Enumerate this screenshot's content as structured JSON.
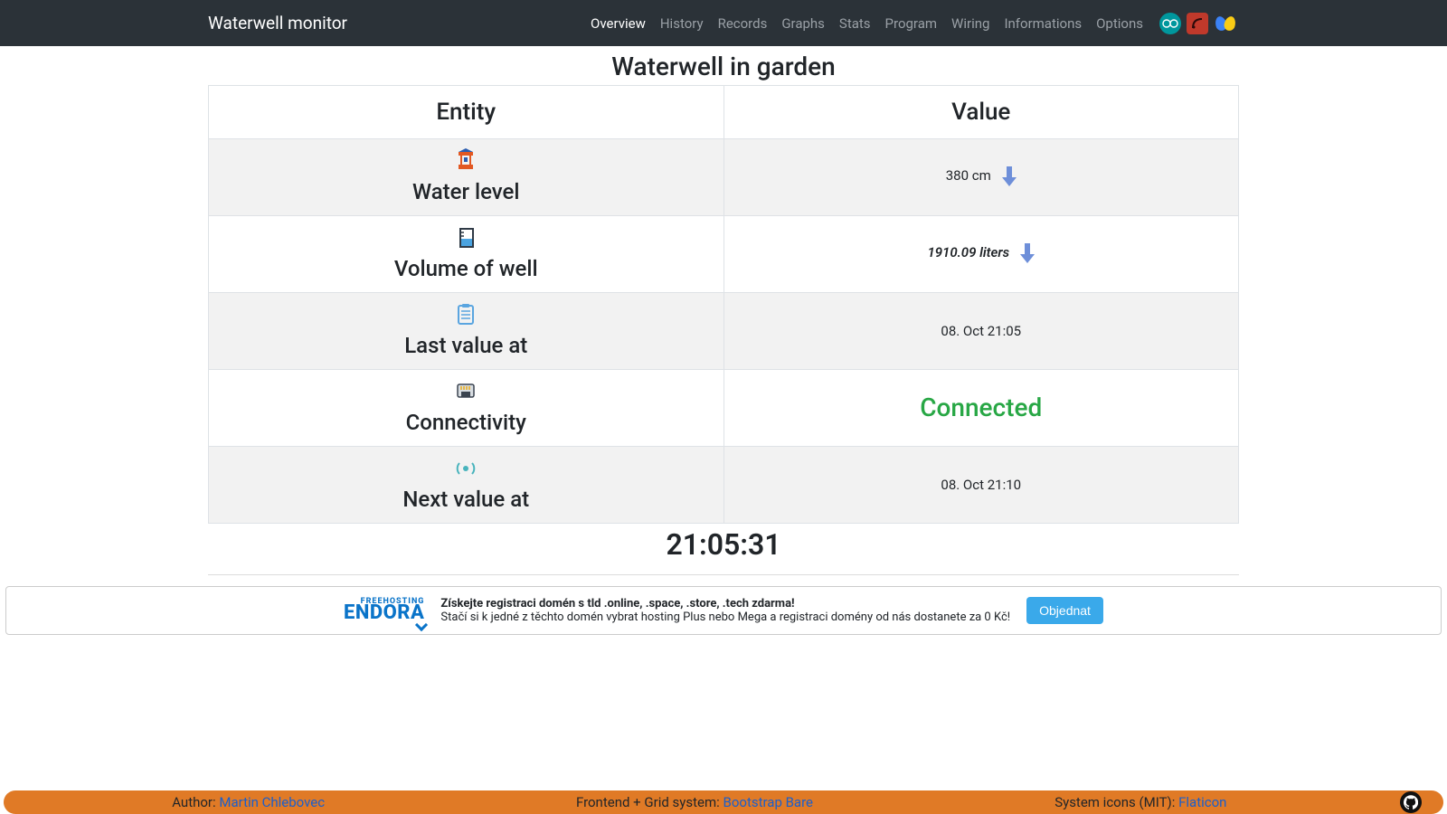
{
  "brand": "Waterwell monitor",
  "nav": [
    {
      "label": "Overview",
      "active": true
    },
    {
      "label": "History",
      "active": false
    },
    {
      "label": "Records",
      "active": false
    },
    {
      "label": "Graphs",
      "active": false
    },
    {
      "label": "Stats",
      "active": false
    },
    {
      "label": "Program",
      "active": false
    },
    {
      "label": "Wiring",
      "active": false
    },
    {
      "label": "Informations",
      "active": false
    },
    {
      "label": "Options",
      "active": false
    }
  ],
  "page_title": "Waterwell in garden",
  "table": {
    "head_entity": "Entity",
    "head_value": "Value"
  },
  "rows": {
    "water_level": {
      "label": "Water level",
      "value": "380 cm"
    },
    "volume": {
      "label": "Volume of well",
      "value": "1910.09 liters"
    },
    "last_at": {
      "label": "Last value at",
      "value": "08. Oct 21:05"
    },
    "connectivity": {
      "label": "Connectivity",
      "value": "Connected"
    },
    "next_at": {
      "label": "Next value at",
      "value": "08. Oct 21:10"
    }
  },
  "clock": "21:05:31",
  "banner": {
    "logo_small": "FREEHOSTING",
    "logo_big": "ENDORA",
    "title": "Získejte registraci domén s tld .online, .space, .store, .tech zdarma!",
    "subtitle": "Stačí si k jedné z těchto domén vybrat hosting Plus nebo Mega a registraci domény od nás dostanete za 0 Kč!",
    "button": "Objednat"
  },
  "footer": {
    "author_label": "Author: ",
    "author_link": "Martin Chlebovec",
    "grid_label": "Frontend + Grid system: ",
    "grid_link": "Bootstrap Bare",
    "icons_label": "System icons (MIT): ",
    "icons_link": "Flaticon"
  }
}
